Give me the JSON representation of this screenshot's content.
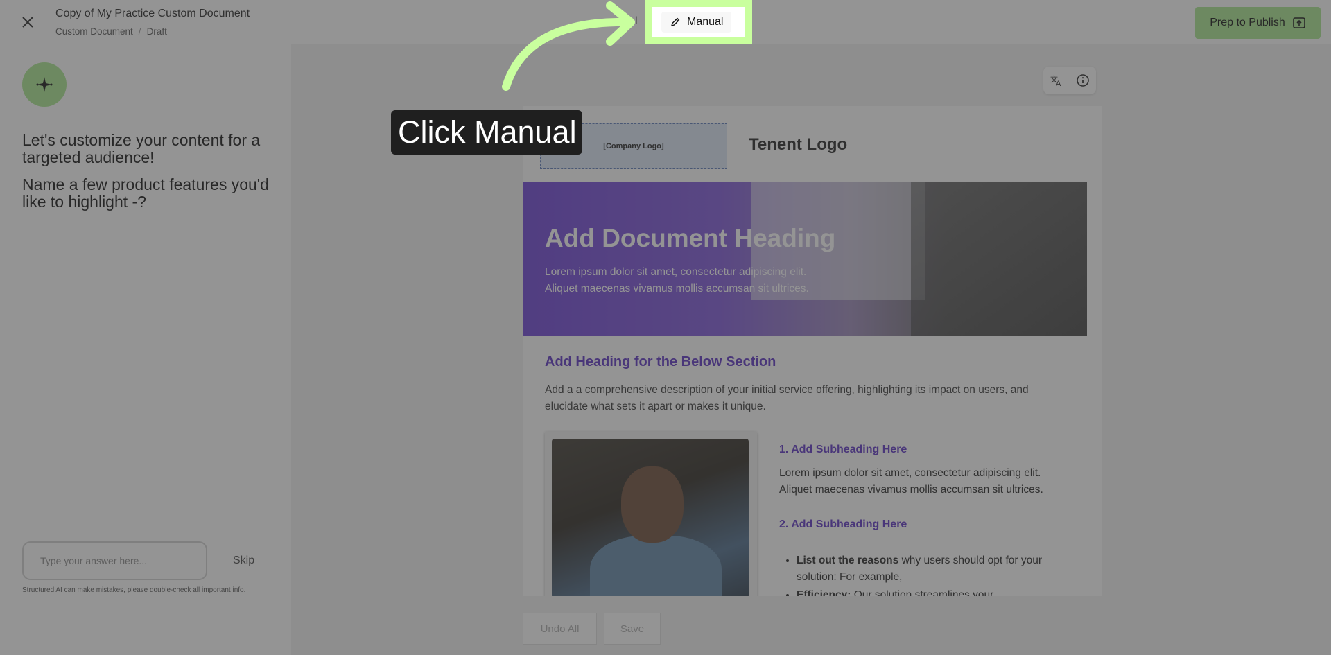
{
  "header": {
    "title": "Copy of My Practice Custom Document",
    "breadcrumb": [
      "Custom Document",
      "Draft"
    ],
    "mode_ai_fragment": "l",
    "mode_manual_label": "Manual",
    "publish_label": "Prep to Publish"
  },
  "left_panel": {
    "prompt_1": "Let's customize your content for a targeted audience!",
    "prompt_2": "Name a few product features you'd like to highlight -?",
    "answer_placeholder": "Type your answer here...",
    "skip_label": "Skip",
    "disclaimer": "Structured AI can make mistakes, please double-check all important info."
  },
  "document": {
    "company_logo_placeholder": "[Company Logo]",
    "tenant_logo": "Tenent Logo",
    "hero_title": "Add Document Heading",
    "hero_text": "Lorem ipsum dolor sit amet, consectetur adipiscing elit. Aliquet maecenas vivamus mollis accumsan sit ultrices.",
    "section_heading": "Add Heading for the Below Section",
    "section_desc": "Add a a comprehensive description of your initial service offering, highlighting its impact on users, and elucidate what sets it apart or makes it unique.",
    "sub_1": "1. Add Subheading Here",
    "sub_1_text": "Lorem ipsum dolor sit amet, consectetur adipiscing elit. Aliquet maecenas vivamus mollis accumsan sit ultrices.",
    "sub_2": "2. Add Subheading Here",
    "bullet_1_bold": "List out the reasons",
    "bullet_1_rest": " why users should opt for your solution: For example,",
    "bullet_2_bold": "Efficiency:",
    "bullet_2_rest": " Our solution streamlines your"
  },
  "footer_buttons": {
    "undo_label": "Undo All",
    "save_label": "Save"
  },
  "tutorial": {
    "tooltip": "Click Manual",
    "highlight_color": "#c9ff9e"
  },
  "icons": {
    "close": "close-icon",
    "pencil": "pencil-icon",
    "publish": "publish-icon",
    "sparkle": "sparkle-icon",
    "translate": "translate-icon",
    "info": "info-icon"
  },
  "colors": {
    "accent_green": "#a8e68e",
    "heading_purple": "#5a2fc4"
  }
}
